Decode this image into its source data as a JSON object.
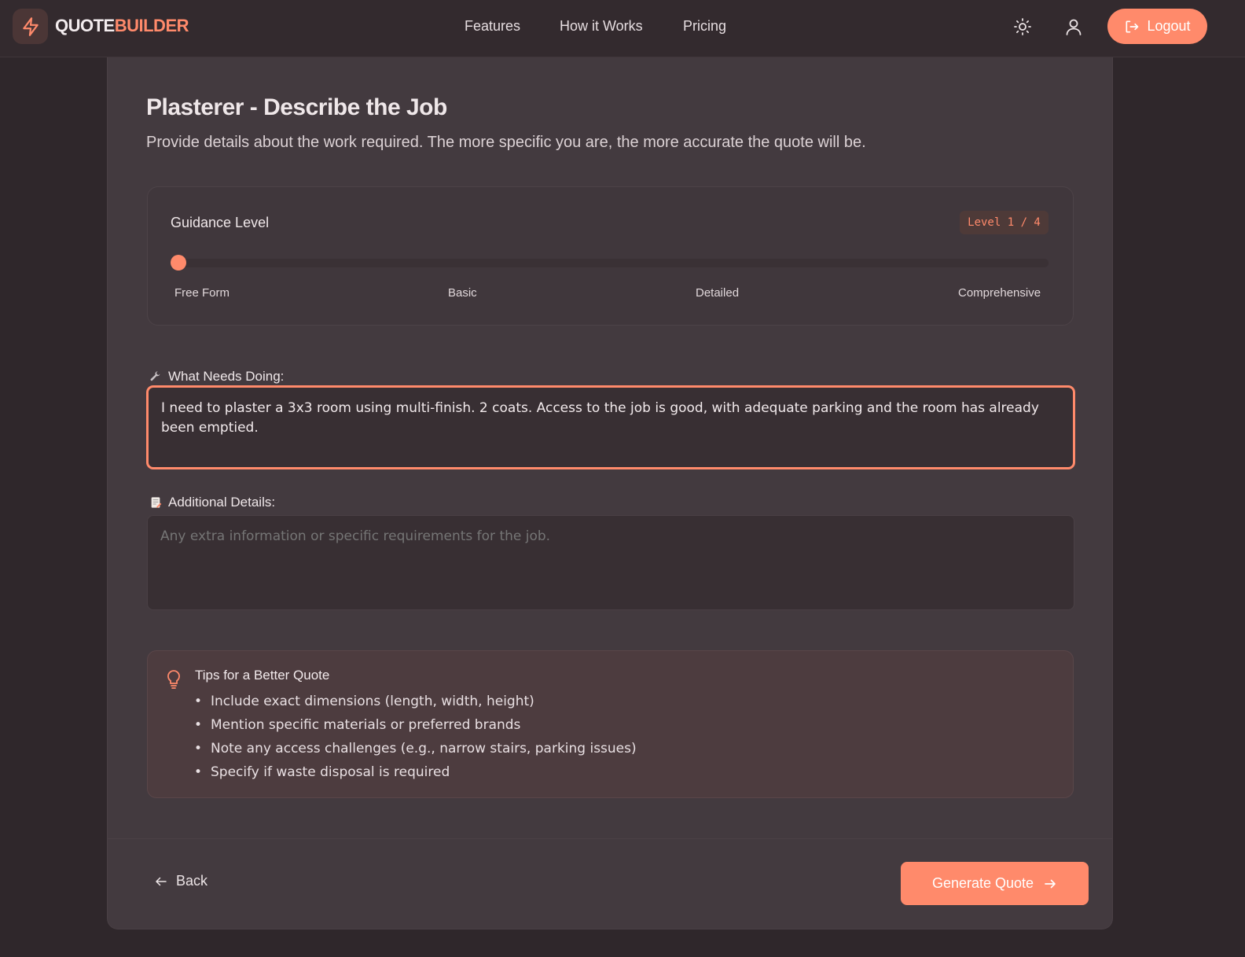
{
  "colors": {
    "accent": "#ff8a6b",
    "background": "#2f272b",
    "card": "#433a3f"
  },
  "header": {
    "logo_icon": "lightning-bolt-icon",
    "logo_part1": "QUOTE",
    "logo_part2": "BUILDER",
    "nav": [
      "Features",
      "How it Works",
      "Pricing"
    ],
    "theme_icon": "sun-icon",
    "profile_icon": "user-icon",
    "logout_label": "Logout",
    "logout_icon": "logout-icon"
  },
  "page": {
    "title": "Plasterer - Describe the Job",
    "subtitle": "Provide details about the work required. The more specific you are, the more accurate the quote will be."
  },
  "guidance": {
    "label": "Guidance Level",
    "badge": "Level 1 / 4",
    "current_level": 1,
    "max_level": 4,
    "ticks": [
      "Free Form",
      "Basic",
      "Detailed",
      "Comprehensive"
    ]
  },
  "what_needs_doing": {
    "icon": "wrench-icon",
    "label": "What Needs Doing:",
    "value": "I need to plaster a 3x3 room using multi-finish. 2 coats. Access to the job is good, with adequate parking and the room has already been emptied."
  },
  "additional_details": {
    "icon": "memo-icon",
    "label": "Additional Details:",
    "placeholder": "Any extra information or specific requirements for the job."
  },
  "tips": {
    "icon": "lightbulb-icon",
    "title": "Tips for a Better Quote",
    "items": [
      "Include exact dimensions (length, width, height)",
      "Mention specific materials or preferred brands",
      "Note any access challenges (e.g., narrow stairs, parking issues)",
      "Specify if waste disposal is required"
    ]
  },
  "footer": {
    "back_label": "Back",
    "back_icon": "arrow-left-icon",
    "generate_label": "Generate Quote",
    "generate_icon": "arrow-right-icon"
  }
}
